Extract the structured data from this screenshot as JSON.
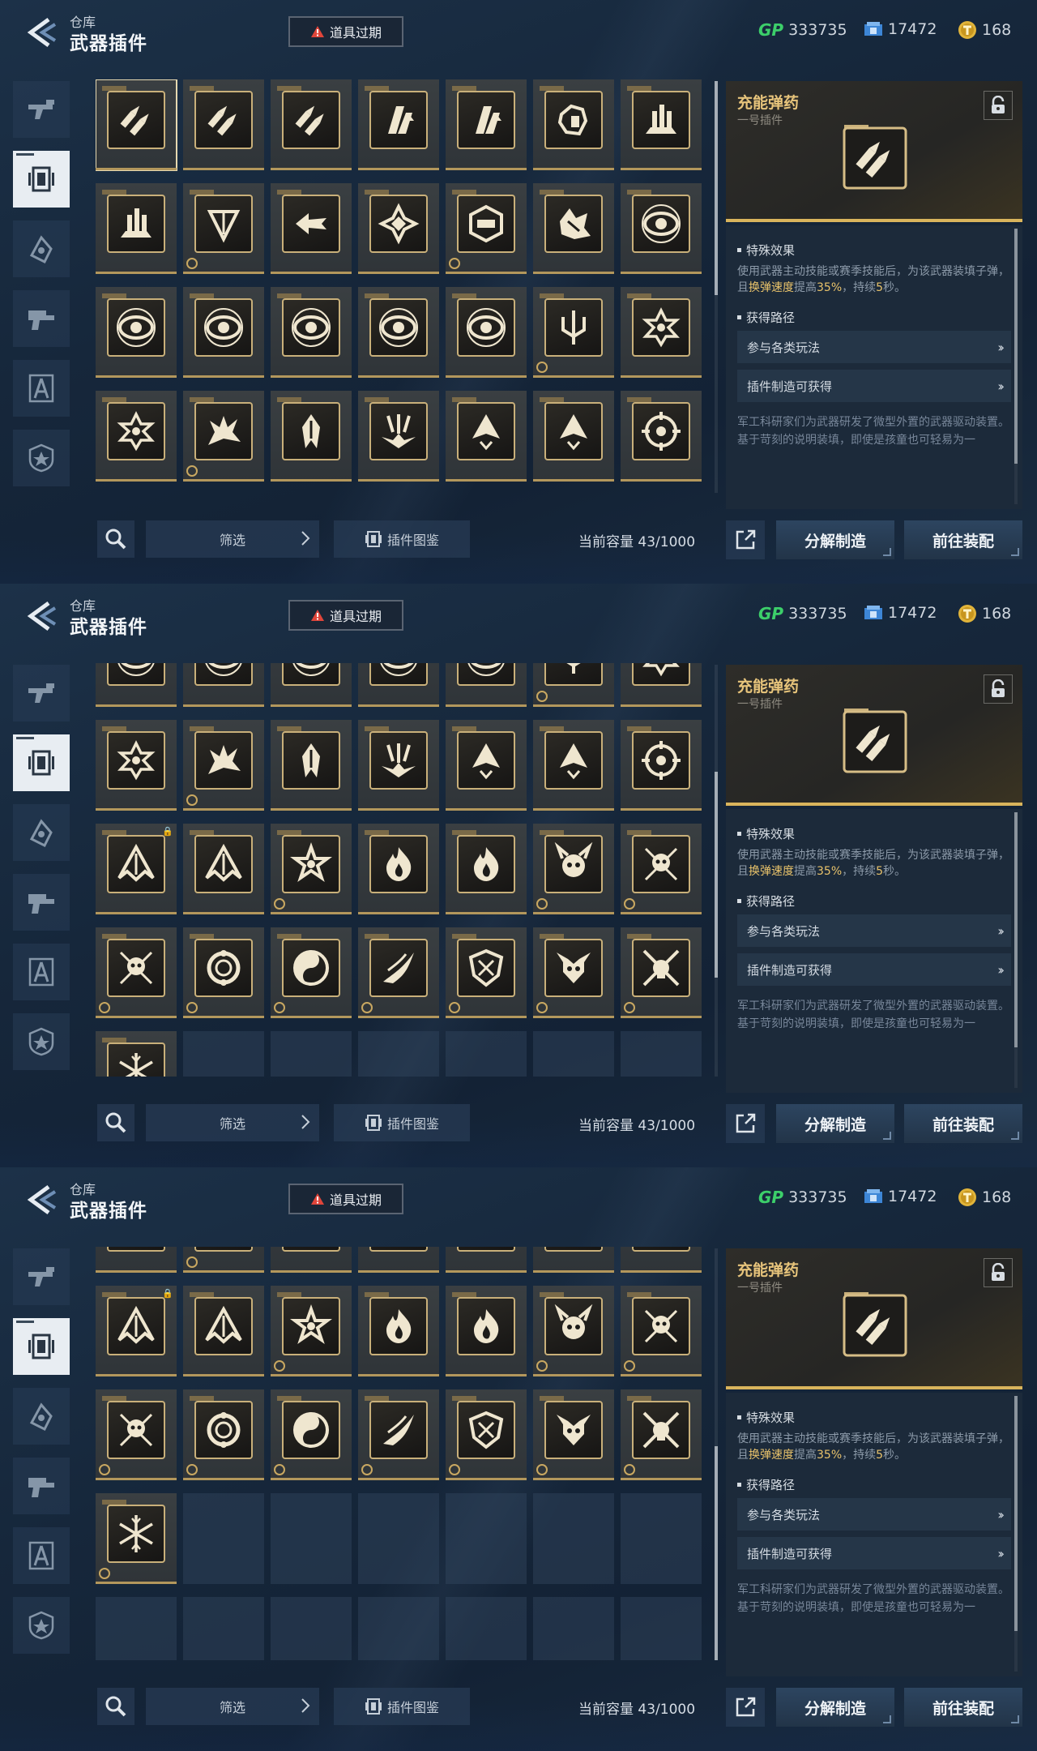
{
  "header": {
    "title_small": "仓库",
    "title_big": "武器插件",
    "expired_label": "道具过期",
    "currencies": [
      {
        "icon": "gp-icon",
        "prefix": "GP",
        "value": "333735"
      },
      {
        "icon": "ticket-icon",
        "value": "17472"
      },
      {
        "icon": "coin-icon",
        "value": "168"
      }
    ]
  },
  "sidebar": {
    "items": [
      {
        "name": "weapon-tab-icon",
        "active": false
      },
      {
        "name": "plugin-tab-icon",
        "active": true
      },
      {
        "name": "skin-tab-icon",
        "active": false
      },
      {
        "name": "gear-tab-icon",
        "active": false
      },
      {
        "name": "compass-tab-icon",
        "active": false
      },
      {
        "name": "badge-tab-icon",
        "active": false
      }
    ]
  },
  "grid": {
    "items": [
      {
        "icon": "bullets-icon",
        "badge": false,
        "lock": false
      },
      {
        "icon": "bullets-icon",
        "badge": false,
        "lock": false
      },
      {
        "icon": "bullets-icon",
        "badge": false,
        "lock": false
      },
      {
        "icon": "magazine-up-icon",
        "badge": false,
        "lock": false
      },
      {
        "icon": "magazine-up-icon",
        "badge": false,
        "lock": false
      },
      {
        "icon": "fragment-icon",
        "badge": false,
        "lock": false
      },
      {
        "icon": "tower-icon",
        "badge": false,
        "lock": false
      },
      {
        "icon": "tower-icon",
        "badge": false,
        "lock": false
      },
      {
        "icon": "cone-icon",
        "badge": true,
        "lock": false
      },
      {
        "icon": "arrow-left-icon",
        "badge": false,
        "lock": false
      },
      {
        "icon": "diamond-icon",
        "badge": false,
        "lock": false
      },
      {
        "icon": "turret-icon",
        "badge": true,
        "lock": false
      },
      {
        "icon": "shatter-icon",
        "badge": false,
        "lock": false
      },
      {
        "icon": "eye-icon",
        "badge": false,
        "lock": false
      },
      {
        "icon": "eye-icon",
        "badge": false,
        "lock": false
      },
      {
        "icon": "eye-icon",
        "badge": false,
        "lock": false
      },
      {
        "icon": "eye-icon",
        "badge": false,
        "lock": false
      },
      {
        "icon": "eye-icon",
        "badge": false,
        "lock": false
      },
      {
        "icon": "eye-icon",
        "badge": false,
        "lock": false
      },
      {
        "icon": "trident-icon",
        "badge": true,
        "lock": false
      },
      {
        "icon": "star-hex-icon",
        "badge": false,
        "lock": false
      },
      {
        "icon": "star-hex-icon",
        "badge": false,
        "lock": false
      },
      {
        "icon": "flare-icon",
        "badge": true,
        "lock": false
      },
      {
        "icon": "spike-icon",
        "badge": false,
        "lock": false
      },
      {
        "icon": "burst-down-icon",
        "badge": false,
        "lock": false
      },
      {
        "icon": "spire-icon",
        "badge": false,
        "lock": false
      },
      {
        "icon": "spire-icon",
        "badge": false,
        "lock": false
      },
      {
        "icon": "crosshair-icon",
        "badge": false,
        "lock": false
      },
      {
        "icon": "wing-icon",
        "badge": false,
        "lock": true
      },
      {
        "icon": "wing-icon",
        "badge": false,
        "lock": false
      },
      {
        "icon": "star-swirl-icon",
        "badge": true,
        "lock": false
      },
      {
        "icon": "flame-icon",
        "badge": false,
        "lock": false
      },
      {
        "icon": "flame-icon",
        "badge": false,
        "lock": false
      },
      {
        "icon": "demon-icon",
        "badge": true,
        "lock": false
      },
      {
        "icon": "skull-arrows-icon",
        "badge": true,
        "lock": false
      },
      {
        "icon": "skull-arrows-icon",
        "badge": true,
        "lock": false
      },
      {
        "icon": "ring-icon",
        "badge": true,
        "lock": false
      },
      {
        "icon": "yin-icon",
        "badge": true,
        "lock": false
      },
      {
        "icon": "wind-icon",
        "badge": true,
        "lock": false
      },
      {
        "icon": "shield-cross-icon",
        "badge": true,
        "lock": false
      },
      {
        "icon": "horns-icon",
        "badge": true,
        "lock": false
      },
      {
        "icon": "crossed-skull-icon",
        "badge": true,
        "lock": false
      },
      {
        "icon": "frost-icon",
        "badge": true,
        "lock": false
      }
    ]
  },
  "detail": {
    "name": "充能弹药",
    "subtitle": "一号插件",
    "effect_heading": "特殊效果",
    "effect_before": "使用武器主动技能或赛季技能后，为该武器装填子弹，且",
    "effect_hl1": "换弹速度",
    "effect_mid": "提高",
    "effect_hl2": "35%",
    "effect_after": "，持续",
    "effect_hl3": "5",
    "effect_end": "秒。",
    "path_heading": "获得路径",
    "paths": [
      "参与各类玩法",
      "插件制造可获得"
    ],
    "lore": "军工科研家们为武器研发了微型外置的武器驱动装置。基于苛刻的说明装填，即使是孩童也可轻易为一"
  },
  "bottom": {
    "filter_label": "筛选",
    "atlas_label": "插件图鉴",
    "capacity": "当前容量 43/1000",
    "dismantle_label": "分解制造",
    "equip_label": "前往装配"
  },
  "screens": [
    {
      "scroll_rows": 0,
      "thumb": [
        0.0,
        0.52
      ]
    },
    {
      "scroll_rows": 3,
      "thumb": [
        0.26,
        0.5
      ]
    },
    {
      "scroll_rows": 4,
      "thumb": [
        0.48,
        0.52
      ]
    }
  ],
  "colors": {
    "accent_gold": "#d9b45c",
    "highlight": "#e9c36b",
    "panel": "#1c2a3a"
  }
}
